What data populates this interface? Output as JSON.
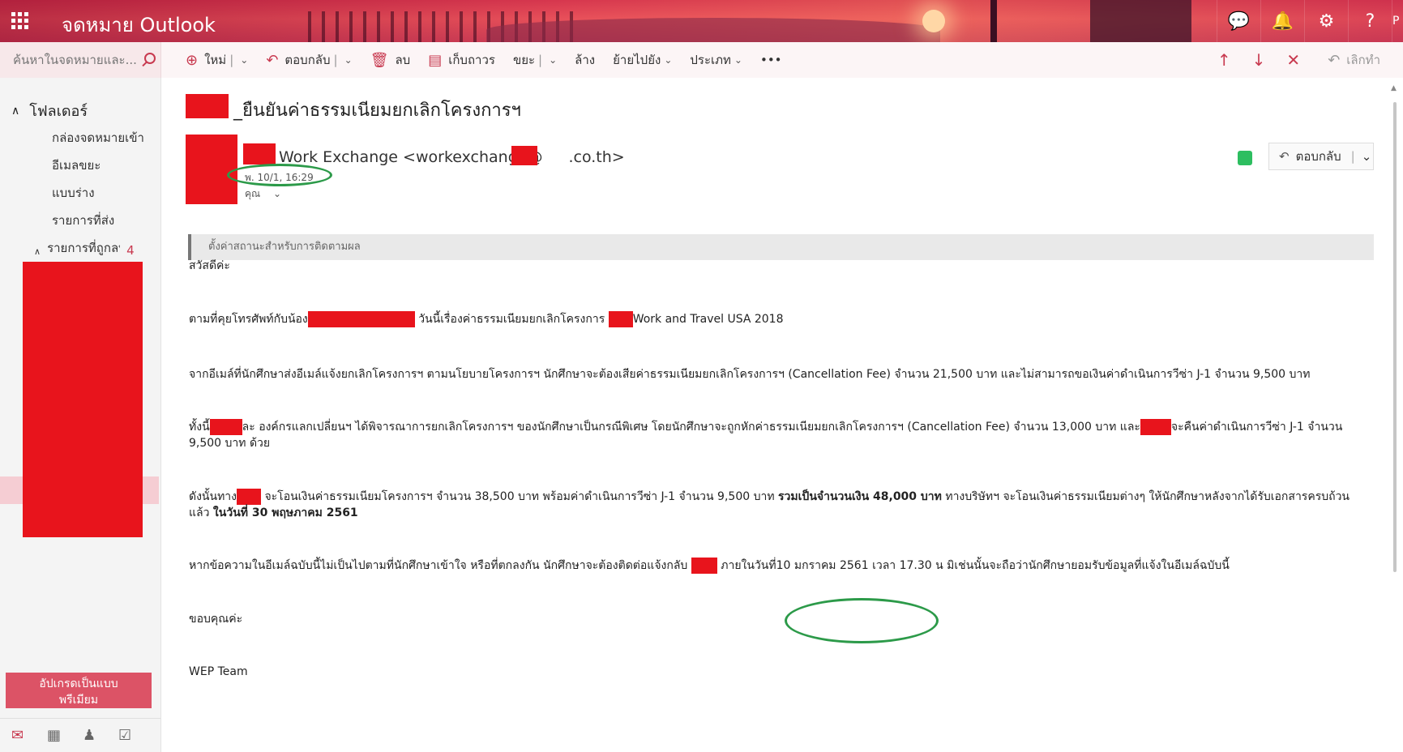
{
  "app": {
    "title": "จดหมาย Outlook"
  },
  "topbar": {
    "icons": [
      "chat-icon",
      "bell-icon",
      "gear-icon",
      "help-icon"
    ],
    "edge_letter": "P"
  },
  "search": {
    "placeholder": "ค้นหาในจดหมายและ..."
  },
  "toolbar": {
    "new_label": "ใหม่",
    "reply_label": "ตอบกลับ",
    "delete_label": "ลบ",
    "archive_label": "เก็บถาวร",
    "junk_label": "ขยะ",
    "sweep_label": "ล้าง",
    "move_label": "ย้ายไปยัง",
    "categorize_label": "ประเภท",
    "more_label": "•••",
    "undo_label": "เลิกทำ"
  },
  "sidebar": {
    "folders_label": "โฟลเดอร์",
    "items": [
      {
        "label": "กล่องจดหมายเข้า"
      },
      {
        "label": "อีเมลขยะ"
      },
      {
        "label": "แบบร่าง"
      },
      {
        "label": "รายการที่ส่ง"
      },
      {
        "label": "รายการที่ถูกลบ",
        "count": "4"
      }
    ],
    "upgrade_line1": "อัปเกรดเป็นแบบ",
    "upgrade_line2": "พรีเมียม"
  },
  "message": {
    "subject": "_ยืนยันค่าธรรมเนียมยกเลิกโครงการฯ",
    "sender_name": "Work Exchange",
    "sender_addr_start": "<workexchange@",
    "sender_addr_end": ".co.th>",
    "sent": "พ. 10/1, 16:29",
    "to": "คุณ",
    "reply_label": "ตอบกลับ",
    "followup": "ตั้งค่าสถานะสำหรับการติดตามผล",
    "greeting": "สวัสดีค่ะ",
    "p1_a": "ตามที่คุยโทรศัพท์กับน้อง",
    "p1_b": "วันนี้เรื่องค่าธรรมเนียมยกเลิกโครงการ",
    "p1_c": "Work and Travel USA 2018",
    "p2": "จากอีเมล์ที่นักศึกษาส่งอีเมล์แจ้งยกเลิกโครงการฯ ตามนโยบายโครงการฯ นักศึกษาจะต้องเสียค่าธรรมเนียมยกเลิกโครงการฯ (Cancellation Fee) จำนวน 21,500 บาท และไม่สามารถขอเงินค่าดำเนินการวีซ่า J-1 จำนวน 9,500 บาท",
    "p3_a": "ทั้งนี้",
    "p3_b": "ละ องค์กรแลกเปลี่ยนฯ ได้พิจารณาการยกเลิกโครงการฯ ของนักศึกษาเป็นกรณีพิเศษ โดยนักศึกษาจะถูกหักค่าธรรมเนียมยกเลิกโครงการฯ (Cancellation Fee) จำนวน 13,000 บาท และ",
    "p3_c": "จะคืนค่าดำเนินการวีซ่า J-1 จำนวน 9,500 บาท ด้วย",
    "p4_a": "ดังนั้นทาง",
    "p4_b": "จะโอนเงินค่าธรรมเนียมโครงการฯ จำนวน 38,500 บาท พร้อมค่าดำเนินการวีซ่า J-1 จำนวน 9,500 บาท",
    "p4_bold1": "รวมเป็นจำนวนเงิน 48,000 บาท",
    "p4_c": "ทางบริษัทฯ จะโอนเงินค่าธรรมเนียมต่างๆ ให้นักศึกษาหลังจากได้รับเอกสารครบถ้วนแล้ว",
    "p4_bold2": "ในวันที่ 30 พฤษภาคม 2561",
    "p5_a": "หากข้อความในอีเมล์ฉบับนี้ไม่เป็นไปตามที่นักศึกษาเข้าใจ หรือที่ตกลงกัน นักศึกษาจะต้องติดต่อแจ้งกลับ",
    "p5_b": "ภายในวันที่",
    "p5_c": "10 มกราคม 2561 เวลา 17.30 น",
    "p5_d": "มิเช่นนั้นจะถือว่านักศึกษายอมรับข้อมูลที่แจ้งในอีเมล์ฉบับนี้",
    "thanks": "ขอบคุณค่ะ",
    "signature": "WEP Team"
  },
  "colors": {
    "accent": "#c8394f",
    "redaction": "#e8141c",
    "annotation": "#2c9a49"
  }
}
